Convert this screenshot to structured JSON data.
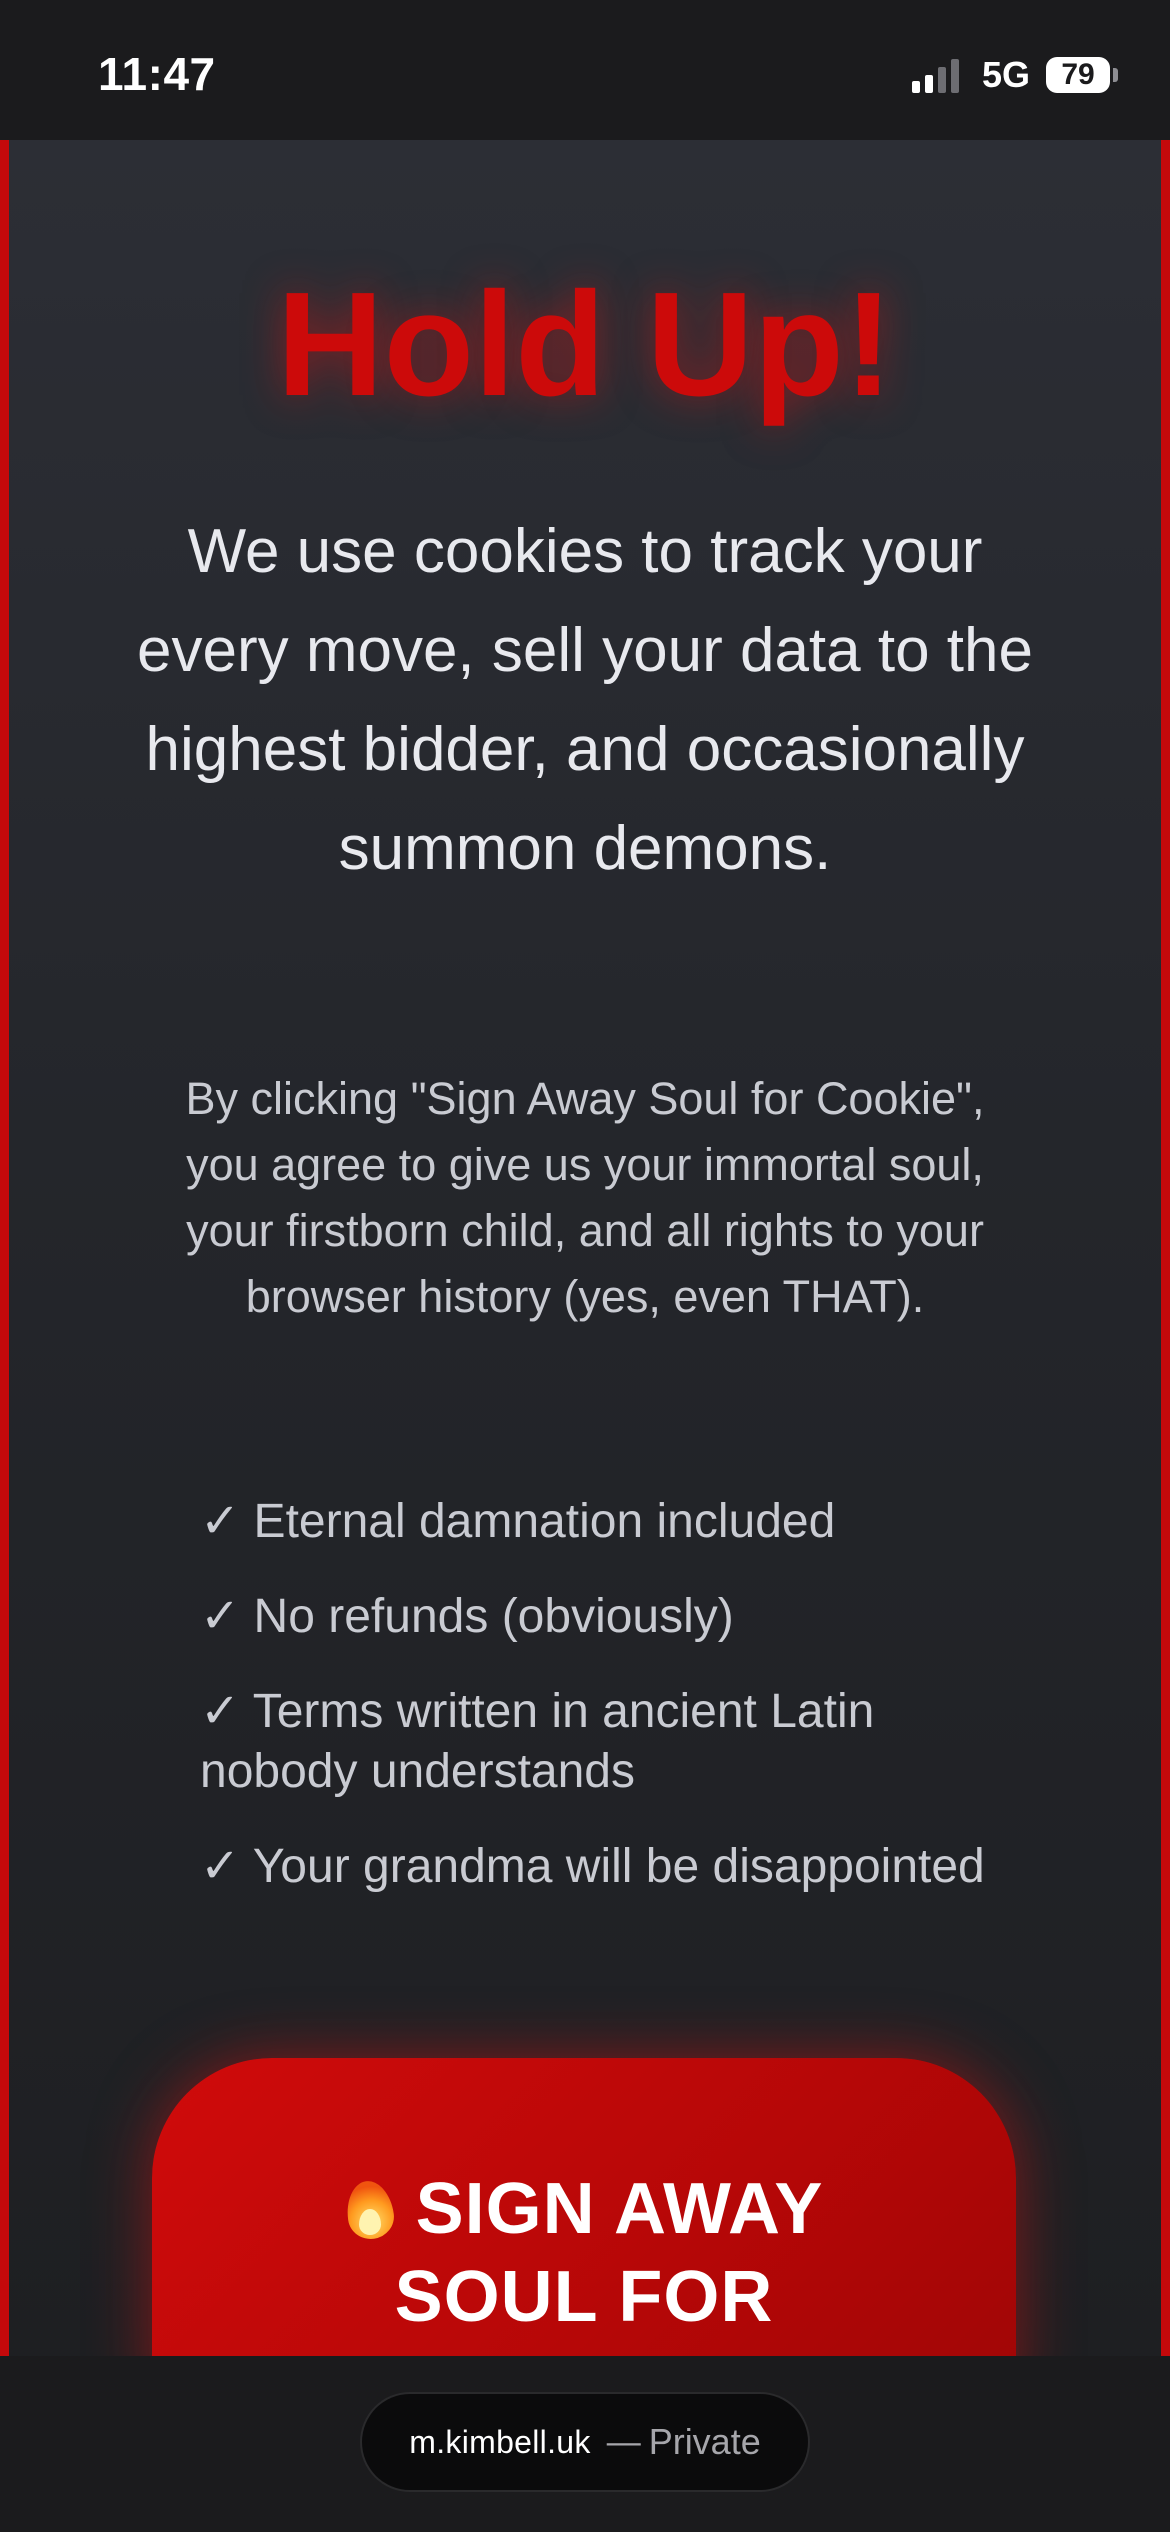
{
  "status_bar": {
    "time": "11:47",
    "network": "5G",
    "battery": "79"
  },
  "page": {
    "headline": "Hold Up!",
    "lead": "We use cookies to track your every move, sell your data to the highest bidder, and occasionally summon demons.",
    "fine_print": "By clicking \"Sign Away Soul for Cookie\", you agree to give us your immortal soul, your firstborn child, and all rights to your browser history (yes, even THAT).",
    "features": [
      "✓ Eternal damnation included",
      "✓ No refunds (obviously)",
      "✓ Terms written in ancient Latin nobody understands",
      "✓ Your grandma will be disappointed"
    ],
    "cta_label": "SIGN AWAY SOUL FOR COOKIE",
    "cta_icon": "fire-emoji"
  },
  "browser": {
    "url": "m.kimbell.uk",
    "separator": "—",
    "mode": "Private"
  },
  "colors": {
    "accent_red": "#cc0a0a",
    "panel_bg": "#2c2e35",
    "text_light": "#e8e9ee"
  }
}
